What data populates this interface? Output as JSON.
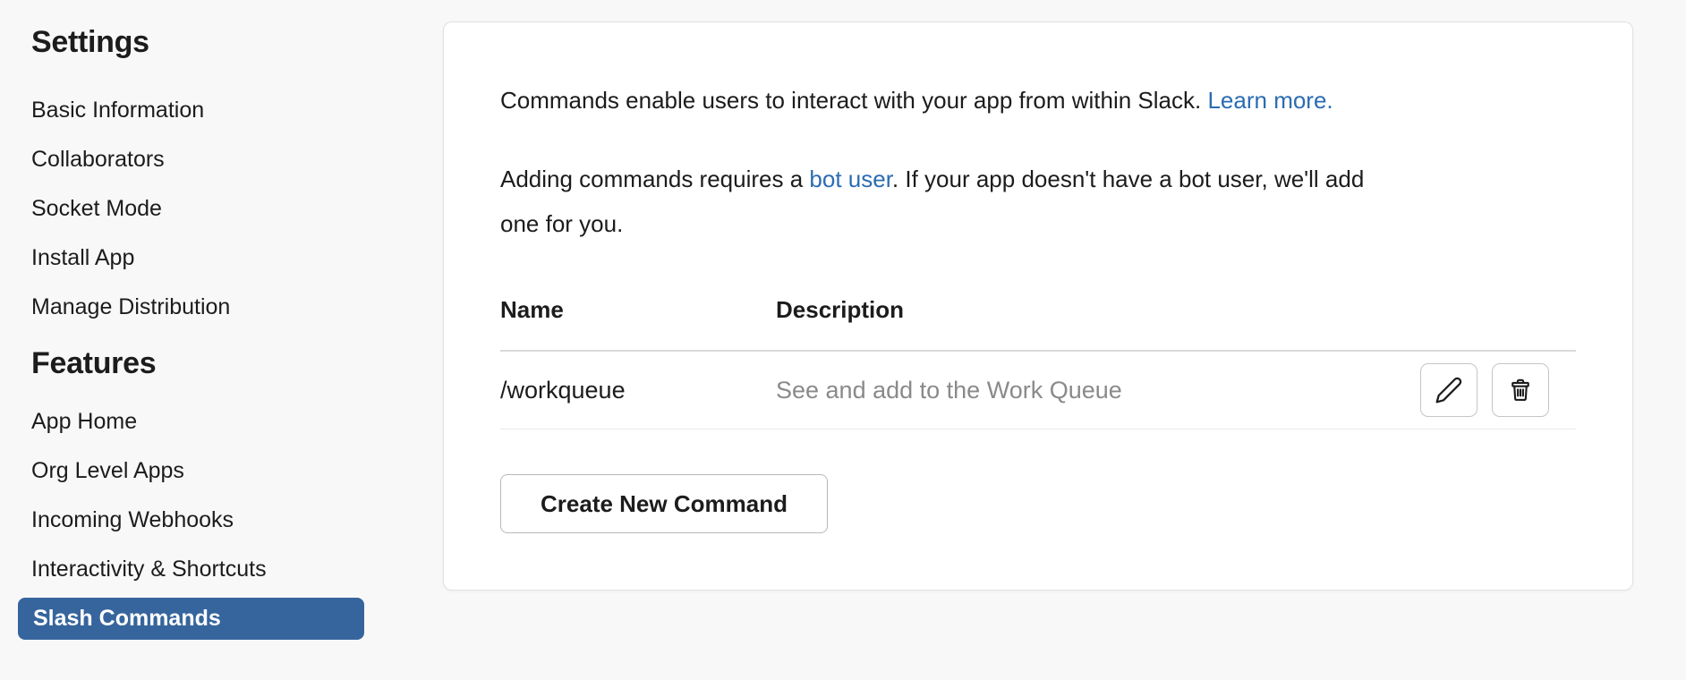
{
  "sidebar": {
    "sections": [
      {
        "heading": "Settings",
        "items": [
          "Basic Information",
          "Collaborators",
          "Socket Mode",
          "Install App",
          "Manage Distribution"
        ]
      },
      {
        "heading": "Features",
        "items": [
          "App Home",
          "Org Level Apps",
          "Incoming Webhooks",
          "Interactivity & Shortcuts",
          "Slash Commands"
        ]
      }
    ],
    "active_item": "Slash Commands"
  },
  "main": {
    "intro_line1": {
      "text": "Commands enable users to interact with your app from within Slack. ",
      "link": "Learn more."
    },
    "intro_line2": {
      "before_link": "Adding commands requires a ",
      "link": "bot user",
      "after_link": ". If your app doesn't have a bot user, we'll add",
      "wrap_line": "one for you."
    },
    "table": {
      "headers": {
        "name": "Name",
        "description": "Description"
      },
      "rows": [
        {
          "name": "/workqueue",
          "description": "See and add to the Work Queue"
        }
      ]
    },
    "row_action_icons": [
      "pencil-icon",
      "trash-icon"
    ],
    "create_button_label": "Create New Command"
  },
  "colors": {
    "page_background": "#f8f8f8",
    "active_nav_blue": "#36659d",
    "link_blue": "#2b6cb2",
    "muted_text": "#8a8a8a"
  }
}
